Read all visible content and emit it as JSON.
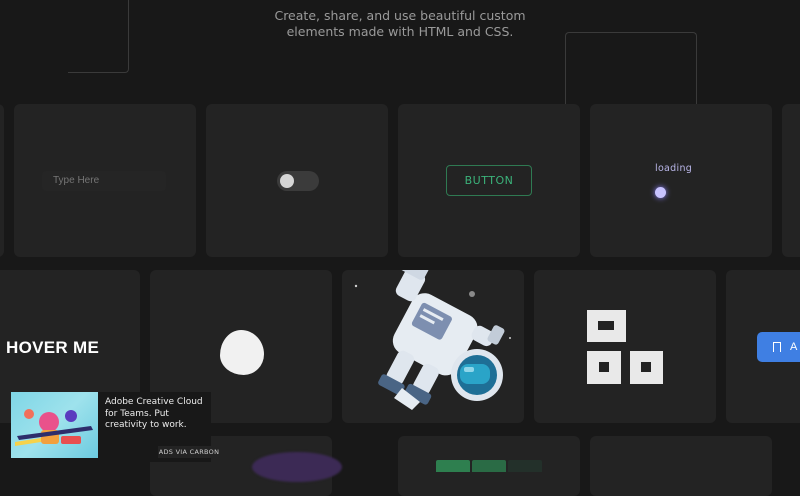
{
  "hero": {
    "tagline_line1": "Create, share, and use beautiful custom",
    "tagline_line2": "elements made with HTML and CSS."
  },
  "elements": {
    "input_placeholder": "Type Here",
    "button_label": "BUTTON",
    "loading_label": "loading",
    "hover_label": "HOVER ME",
    "blue_button_label": "A"
  },
  "ad": {
    "text": "Adobe Creative Cloud for Teams. Put creativity to work.",
    "via": "ADS VIA CARBON"
  },
  "colors": {
    "background": "#181818",
    "card": "#232323",
    "button_accent": "#3bb27a",
    "loader_accent": "#c8c3ff",
    "blue_button": "#3f7fe3"
  },
  "toggle": {
    "on": false
  }
}
